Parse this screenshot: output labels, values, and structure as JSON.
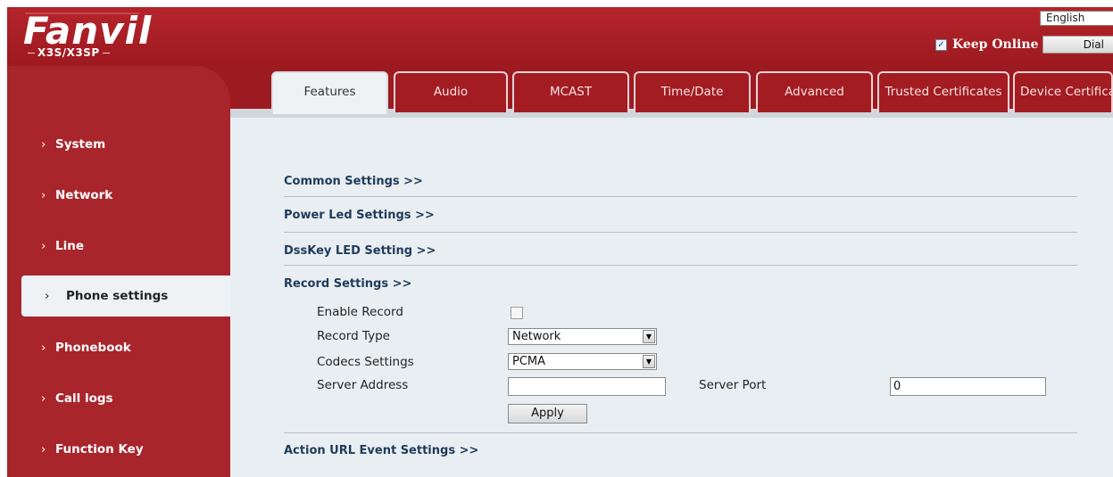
{
  "header": {
    "logo_text": "Fanvil",
    "model_text": "X3S/X3SP",
    "language": "English",
    "keep_online_label": "Keep Online",
    "keep_online_checked": true,
    "dial_label": "Dial"
  },
  "tabs": [
    {
      "label": "Features",
      "active": true
    },
    {
      "label": "Audio",
      "active": false
    },
    {
      "label": "MCAST",
      "active": false
    },
    {
      "label": "Time/Date",
      "active": false
    },
    {
      "label": "Advanced",
      "active": false
    },
    {
      "label": "Trusted Certificates",
      "active": false
    },
    {
      "label": "Device Certifica",
      "active": false
    }
  ],
  "sidebar": {
    "items": [
      {
        "label": "System",
        "active": false
      },
      {
        "label": "Network",
        "active": false
      },
      {
        "label": "Line",
        "active": false
      },
      {
        "label": "Phone settings",
        "active": true
      },
      {
        "label": "Phonebook",
        "active": false
      },
      {
        "label": "Call logs",
        "active": false
      },
      {
        "label": "Function Key",
        "active": false
      }
    ]
  },
  "content": {
    "sections": {
      "common": "Common Settings >>",
      "power_led": "Power Led Settings >>",
      "dsskey_led": "DssKey LED Setting >>",
      "record": "Record Settings >>",
      "action_url": "Action URL Event Settings >>"
    },
    "record": {
      "enable_label": "Enable Record",
      "enable_checked": false,
      "type_label": "Record Type",
      "type_value": "Network",
      "codecs_label": "Codecs Settings",
      "codecs_value": "PCMA",
      "server_address_label": "Server Address",
      "server_address_value": "",
      "server_port_label": "Server Port",
      "server_port_value": "0",
      "apply_label": "Apply"
    }
  },
  "colors": {
    "brand_red": "#a9252c",
    "content_bg": "#e9eef2",
    "section_text": "#1f3b5a"
  }
}
